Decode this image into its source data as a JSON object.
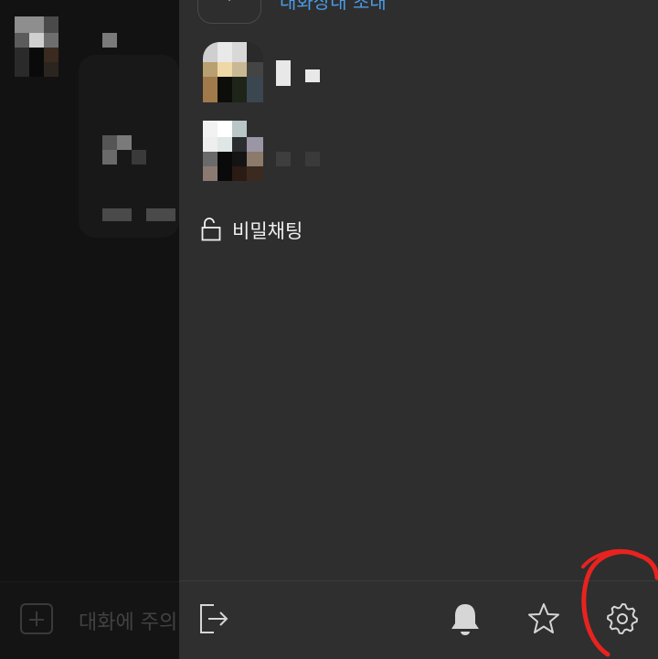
{
  "chat": {
    "input_placeholder": "대화에 주의"
  },
  "drawer": {
    "invite_label": "대화상대 초대",
    "secret_chat_label": "비밀채팅"
  },
  "icons": {
    "invite": "plus-icon",
    "secret_chat": "lock-icon",
    "exit": "exit-icon",
    "notifications": "bell-icon",
    "favorites": "star-icon",
    "settings": "gear-icon"
  },
  "colors": {
    "drawer_background": "#2e2e2e",
    "chat_background": "#121212",
    "invite_text": "#4b9be6",
    "icon": "#d6d6d6",
    "annotation": "#e8231f"
  }
}
